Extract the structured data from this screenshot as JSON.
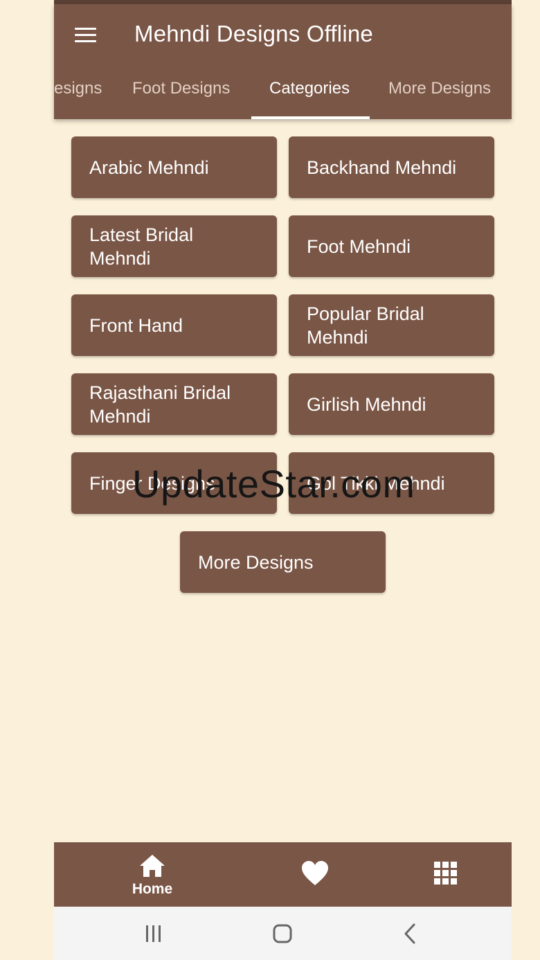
{
  "app": {
    "title": "Mehndi Designs Offline",
    "menu_icon": "menu-icon"
  },
  "tabs": [
    {
      "label": "Designs",
      "visible_text": "esigns",
      "active": false
    },
    {
      "label": "Foot Designs",
      "active": false
    },
    {
      "label": "Categories",
      "active": true
    },
    {
      "label": "More Designs",
      "active": false
    }
  ],
  "categories": [
    {
      "label": "Arabic Mehndi"
    },
    {
      "label": "Backhand Mehndi"
    },
    {
      "label": "Latest Bridal Mehndi"
    },
    {
      "label": "Foot Mehndi"
    },
    {
      "label": "Front Hand"
    },
    {
      "label": "Popular Bridal Mehndi"
    },
    {
      "label": "Rajasthani Bridal Mehndi"
    },
    {
      "label": "Girlish Mehndi"
    },
    {
      "label": "Finger Designs"
    },
    {
      "label": "Gol Tikki Mehndi"
    }
  ],
  "more_designs_button": {
    "label": "More Designs"
  },
  "watermark": {
    "text": "UpdateStar.com"
  },
  "bottom_nav": {
    "items": [
      {
        "icon": "home-icon",
        "label": "Home",
        "active": true
      },
      {
        "icon": "heart-icon",
        "active": false
      },
      {
        "icon": "grid-icon",
        "active": false
      }
    ]
  },
  "system_nav": {
    "icons": [
      "recent-apps-icon",
      "home-circle-icon",
      "back-icon"
    ]
  },
  "colors": {
    "background": "#fbf0d9",
    "primary": "#7a5646",
    "status_bar": "#5a4035",
    "inactive_tab": "#e2cfc3",
    "text_on_primary": "#ffffff",
    "system_nav_background": "#f4f4f4"
  }
}
